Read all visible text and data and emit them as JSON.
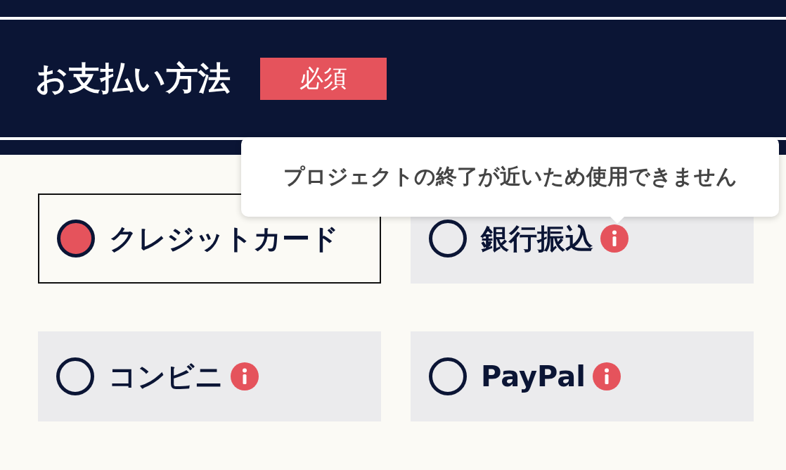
{
  "header": {
    "title": "お支払い方法",
    "badge": "必須"
  },
  "tooltip": {
    "text": "プロジェクトの終了が近いため使用できません"
  },
  "options": [
    {
      "label": "クレジットカード",
      "selected": true,
      "info": false
    },
    {
      "label": "銀行振込",
      "selected": false,
      "info": true
    },
    {
      "label": "コンビニ",
      "selected": false,
      "info": true
    },
    {
      "label": "PayPal",
      "selected": false,
      "info": true
    }
  ]
}
